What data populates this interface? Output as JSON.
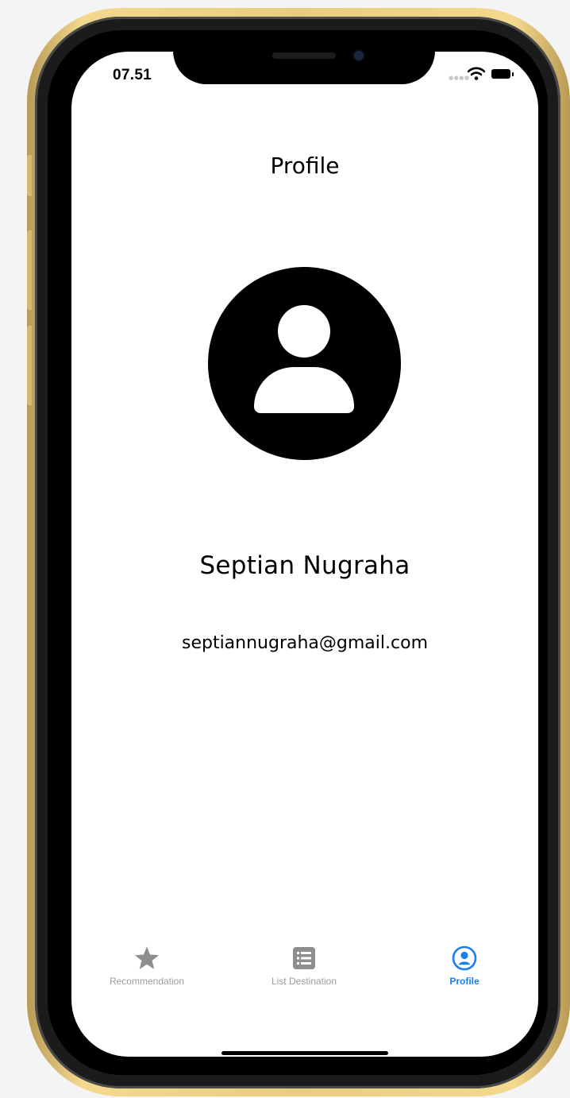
{
  "status_bar": {
    "time": "07.51",
    "signal_icon": "signal-dots-icon",
    "wifi_icon": "wifi-icon",
    "battery_icon": "battery-icon"
  },
  "header": {
    "title": "Profile"
  },
  "profile": {
    "avatar_icon": "person-circle-icon",
    "name": "Septian Nugraha",
    "email": "septiannugraha@gmail.com"
  },
  "tab_bar": {
    "items": [
      {
        "label": "Recommendation",
        "icon": "star-icon",
        "active": false
      },
      {
        "label": "List Destination",
        "icon": "list-icon",
        "active": false
      },
      {
        "label": "Profile",
        "icon": "person-circle-icon",
        "active": true
      }
    ],
    "colors": {
      "active": "#1a7ef5",
      "inactive": "#9c9c9c"
    }
  },
  "device": {
    "frame_color": "#e9cc7f"
  }
}
